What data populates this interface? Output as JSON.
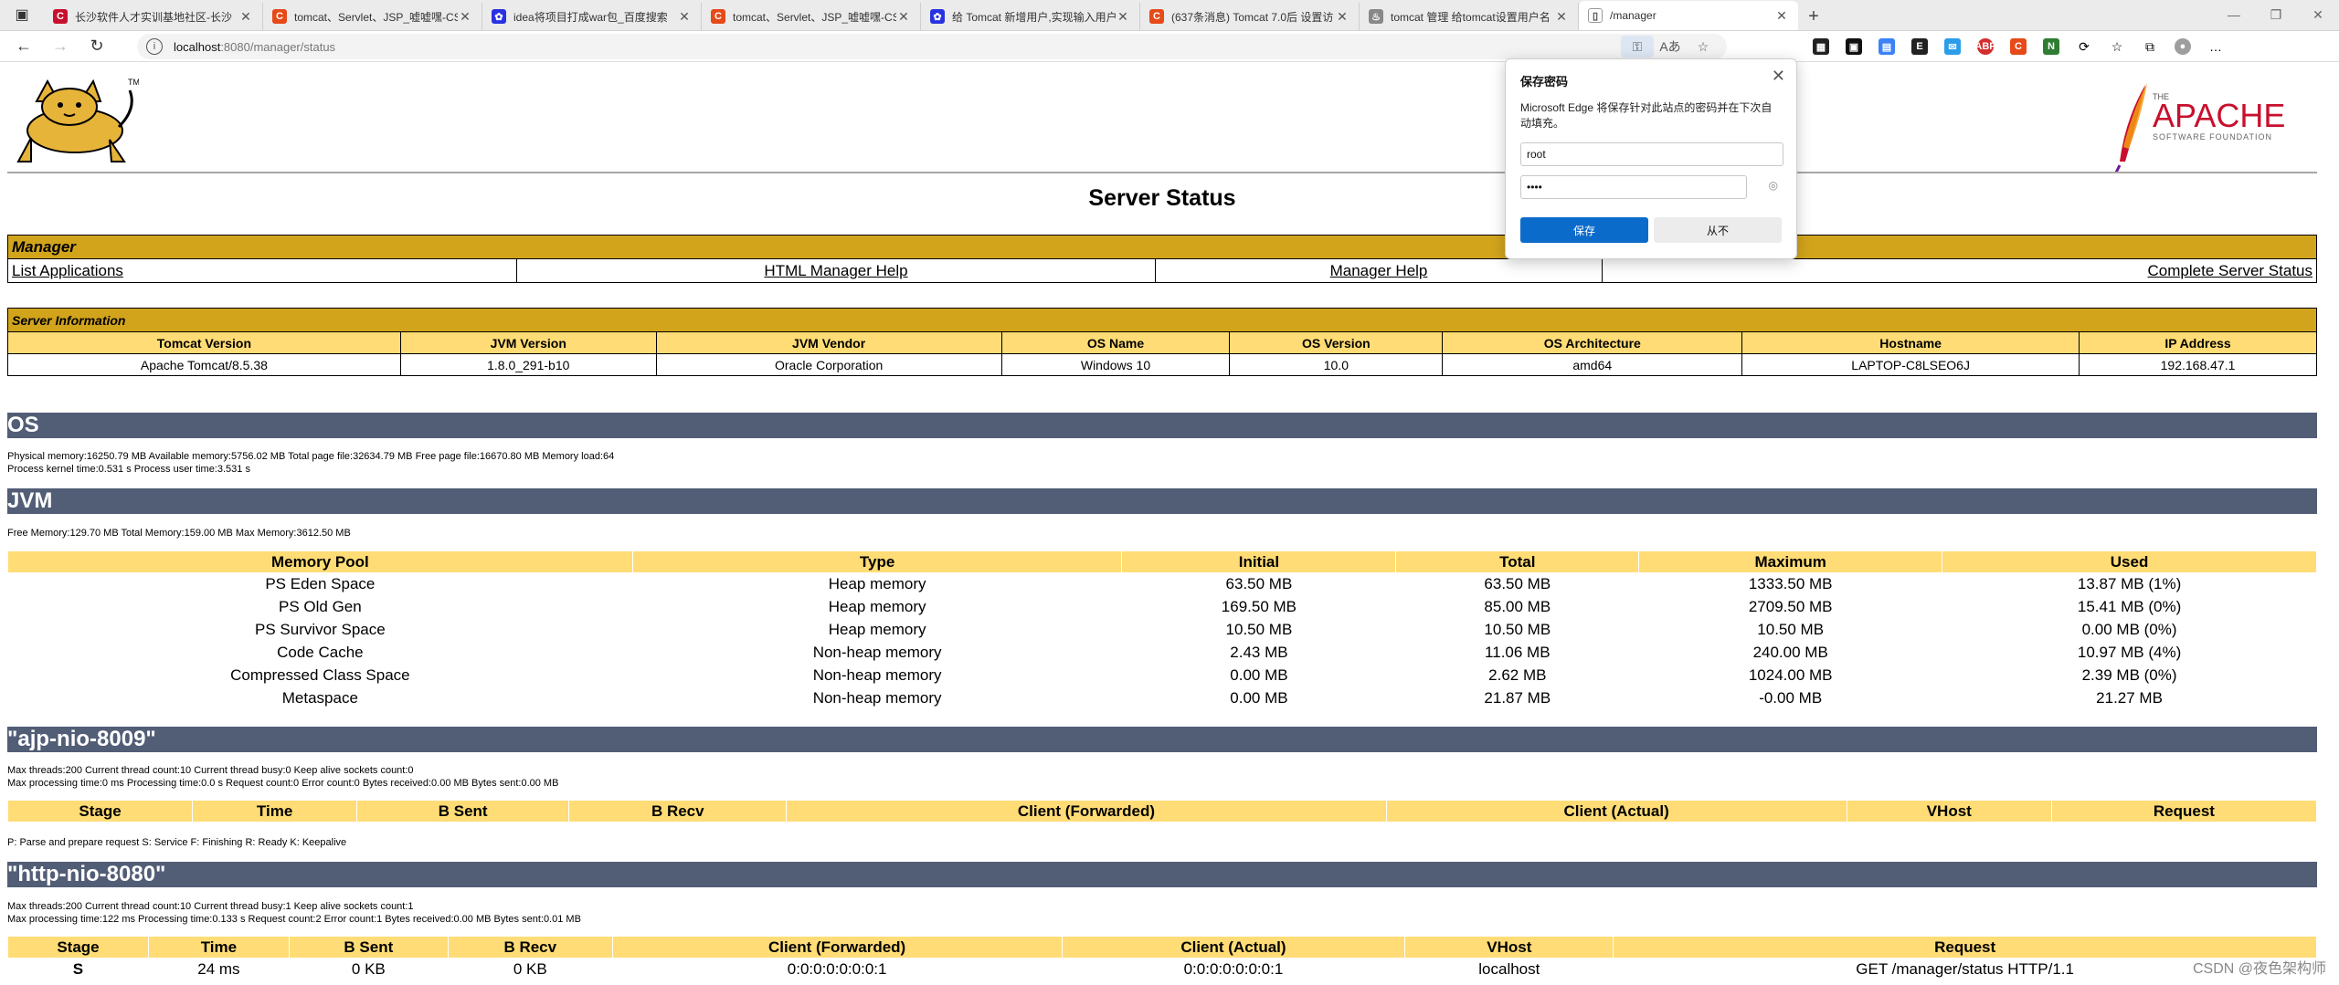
{
  "browser": {
    "tabs": [
      {
        "title": "长沙软件人才实训基地社区-长沙",
        "icon_color": "#c8102e",
        "icon_text": "C"
      },
      {
        "title": "tomcat、Servlet、JSP_嘘嘘嘿-CS",
        "icon_color": "#e64a19",
        "icon_text": "C"
      },
      {
        "title": "idea将项目打成war包_百度搜索",
        "icon_color": "#2932e1",
        "icon_text": "✿"
      },
      {
        "title": "tomcat、Servlet、JSP_嘘嘘嘿-CS",
        "icon_color": "#e64a19",
        "icon_text": "C"
      },
      {
        "title": "给 Tomcat 新增用户,实现输入用户",
        "icon_color": "#2932e1",
        "icon_text": "✿"
      },
      {
        "title": "(637条消息) Tomcat 7.0后 设置访",
        "icon_color": "#e64a19",
        "icon_text": "C"
      },
      {
        "title": "tomcat 管理 给tomcat设置用户名",
        "icon_color": "#888888",
        "icon_text": "♨"
      },
      {
        "title": "/manager",
        "icon_color": "#ffffff",
        "icon_text": "▯",
        "active": true
      }
    ],
    "url_host": "localhost",
    "url_path": ":8080/manager/status"
  },
  "page": {
    "title": "Server Status",
    "manager": {
      "header": "Manager",
      "links": [
        "List Applications",
        "HTML Manager Help",
        "Manager Help",
        "Complete Server Status"
      ]
    },
    "server_info": {
      "header": "Server Information",
      "columns": [
        "Tomcat Version",
        "JVM Version",
        "JVM Vendor",
        "OS Name",
        "OS Version",
        "OS Architecture",
        "Hostname",
        "IP Address"
      ],
      "values": [
        "Apache Tomcat/8.5.38",
        "1.8.0_291-b10",
        "Oracle Corporation",
        "Windows 10",
        "10.0",
        "amd64",
        "LAPTOP-C8LSEO6J",
        "192.168.47.1"
      ]
    },
    "os": {
      "header": "OS",
      "line1": "Physical memory:16250.79 MB Available memory:5756.02 MB Total page file:32634.79 MB Free page file:16670.80 MB Memory load:64",
      "line2": "Process kernel time:0.531 s Process user time:3.531 s"
    },
    "jvm": {
      "header": "JVM",
      "line1": "Free Memory:129.70 MB Total Memory:159.00 MB Max Memory:3612.50 MB",
      "columns": [
        "Memory Pool",
        "Type",
        "Initial",
        "Total",
        "Maximum",
        "Used"
      ],
      "rows": [
        [
          "PS Eden Space",
          "Heap memory",
          "63.50 MB",
          "63.50 MB",
          "1333.50 MB",
          "13.87 MB (1%)"
        ],
        [
          "PS Old Gen",
          "Heap memory",
          "169.50 MB",
          "85.00 MB",
          "2709.50 MB",
          "15.41 MB (0%)"
        ],
        [
          "PS Survivor Space",
          "Heap memory",
          "10.50 MB",
          "10.50 MB",
          "10.50 MB",
          "0.00 MB (0%)"
        ],
        [
          "Code Cache",
          "Non-heap memory",
          "2.43 MB",
          "11.06 MB",
          "240.00 MB",
          "10.97 MB (4%)"
        ],
        [
          "Compressed Class Space",
          "Non-heap memory",
          "0.00 MB",
          "2.62 MB",
          "1024.00 MB",
          "2.39 MB (0%)"
        ],
        [
          "Metaspace",
          "Non-heap memory",
          "0.00 MB",
          "21.87 MB",
          "-0.00 MB",
          "21.27 MB"
        ]
      ]
    },
    "ajp": {
      "header": "\"ajp-nio-8009\"",
      "line1": "Max threads:200 Current thread count:10 Current thread busy:0 Keep alive sockets count:0",
      "line2": "Max processing time:0 ms Processing time:0.0 s Request count:0 Error count:0 Bytes received:0.00 MB Bytes sent:0.00 MB",
      "columns": [
        "Stage",
        "Time",
        "B Sent",
        "B Recv",
        "Client (Forwarded)",
        "Client (Actual)",
        "VHost",
        "Request"
      ],
      "legend": "P: Parse and prepare request S: Service F: Finishing R: Ready K: Keepalive"
    },
    "http": {
      "header": "\"http-nio-8080\"",
      "line1": "Max threads:200 Current thread count:10 Current thread busy:1 Keep alive sockets count:1",
      "line2": "Max processing time:122 ms Processing time:0.133 s Request count:2 Error count:1 Bytes received:0.00 MB Bytes sent:0.01 MB",
      "columns": [
        "Stage",
        "Time",
        "B Sent",
        "B Recv",
        "Client (Forwarded)",
        "Client (Actual)",
        "VHost",
        "Request"
      ],
      "row": [
        "S",
        "24 ms",
        "0 KB",
        "0 KB",
        "0:0:0:0:0:0:0:1",
        "0:0:0:0:0:0:0:1",
        "localhost",
        "GET /manager/status HTTP/1.1"
      ]
    }
  },
  "dialog": {
    "title": "保存密码",
    "desc": "Microsoft Edge 将保存针对此站点的密码并在下次自动填充。",
    "username": "root",
    "password": "••••",
    "save": "保存",
    "never": "从不"
  },
  "watermark": "CSDN @夜色架构师"
}
